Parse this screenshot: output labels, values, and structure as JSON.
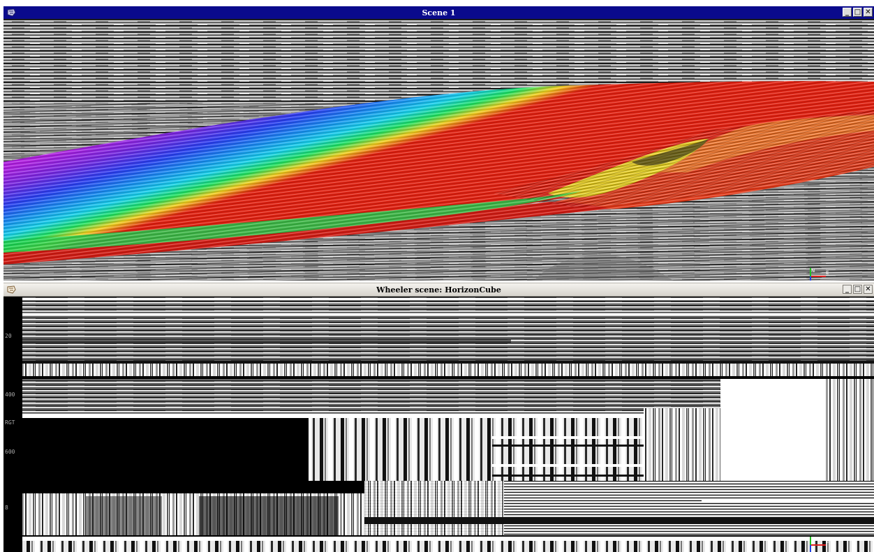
{
  "scene": {
    "title": "Scene 1",
    "icon": "scene-icon",
    "buttons": {
      "minimize": "_",
      "maximize": "□",
      "close": "✕"
    }
  },
  "wheeler": {
    "title": "Wheeler scene: HorizonCube",
    "icon": "scene-icon",
    "buttons": {
      "minimize": "_",
      "maximize": "□",
      "close": "✕"
    },
    "axis": {
      "label": "RGT",
      "ticks": [
        "20",
        "400",
        "600",
        "8"
      ]
    }
  },
  "compass": {
    "north": "N",
    "east": "E",
    "down": "Z"
  },
  "colors": {
    "scene_titlebar": "#0a0a8c",
    "horizon_ramp": [
      "#b020e0",
      "#7a28e0",
      "#2a40f0",
      "#1890f0",
      "#18d0e8",
      "#20e060",
      "#b0e020",
      "#f0e020",
      "#f08020",
      "#e02010"
    ]
  }
}
